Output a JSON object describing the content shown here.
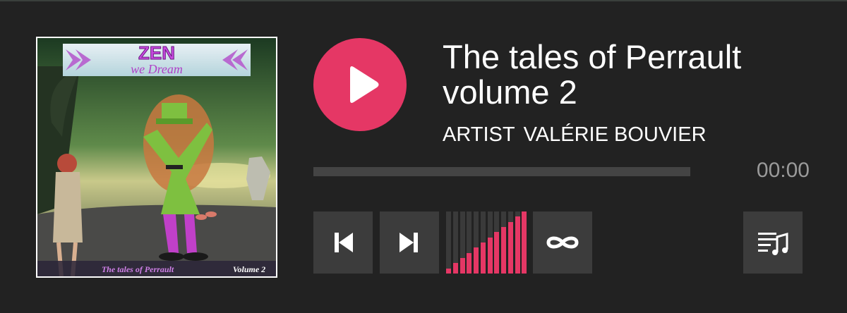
{
  "player": {
    "title": "The tales of Perrault volume 2",
    "artist_label": "ARTIST",
    "artist_name": "VALÉRIE BOUVIER",
    "time": "00:00",
    "progress": 0,
    "volume_steps_total": 12,
    "volume_steps_active": 12,
    "volume_level": 1.0,
    "accent_color": "#e53765"
  },
  "cover": {
    "heading": "ZEN",
    "subheading": "we Dream",
    "footer_title": "The tales of Perrault",
    "footer_volume": "Volume 2"
  },
  "controls": {
    "play_icon": "play-icon",
    "prev_icon": "skip-previous-icon",
    "next_icon": "skip-next-icon",
    "loop_icon": "loop-icon",
    "playlist_icon": "playlist-icon"
  }
}
